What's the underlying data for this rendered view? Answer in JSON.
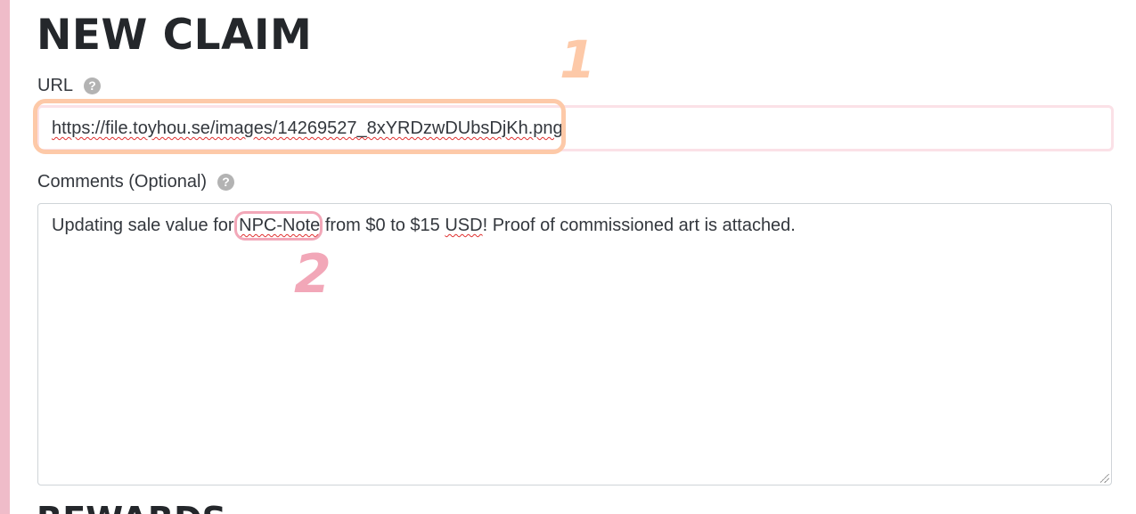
{
  "page": {
    "title": "NEW CLAIM",
    "next_section_title": "REWARDS"
  },
  "url_field": {
    "label": "URL",
    "value": "https://file.toyhou.se/images/14269527_8xYRDzwDUbsDjKh.png",
    "help_icon": "question-circle-icon"
  },
  "comments_field": {
    "label": "Comments (Optional)",
    "help_icon": "question-circle-icon",
    "text_before": "Updating sale value for ",
    "character_name": "NPC-Note",
    "text_middle": " from $0 to $15 ",
    "currency": "USD",
    "text_after": "! Proof of commissioned art is attached."
  },
  "annotations": {
    "marker_1": "1",
    "marker_2": "2",
    "color_1": "#fdc9a8",
    "color_2": "#f2a7b8"
  },
  "colors": {
    "side_accent": "#efbcc9",
    "input_border": "#fbe1e7",
    "spellcheck": "#e0302f"
  }
}
